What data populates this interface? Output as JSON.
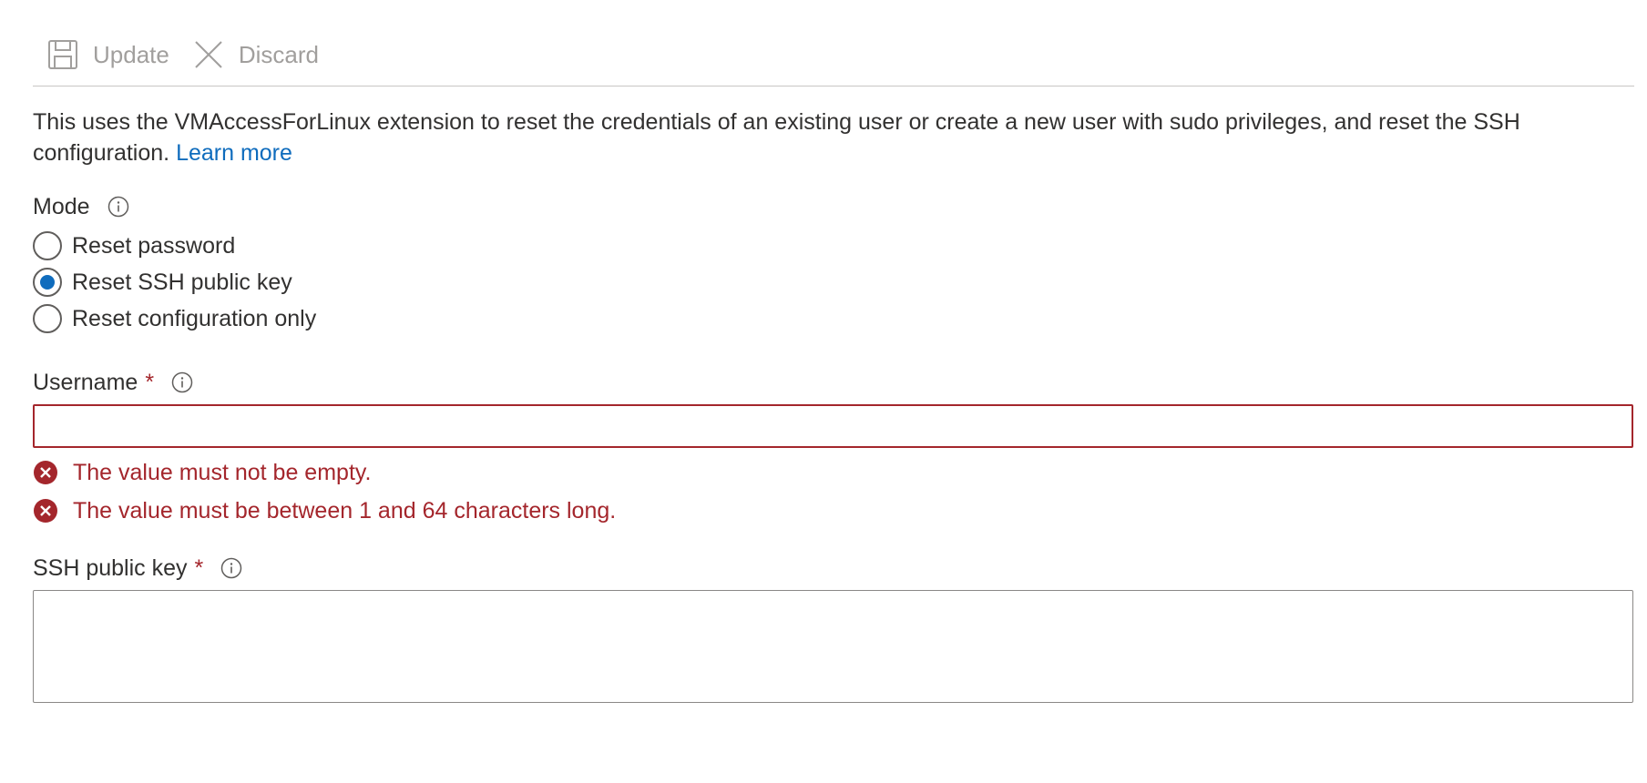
{
  "toolbar": {
    "update_label": "Update",
    "discard_label": "Discard"
  },
  "description": {
    "text": "This uses the VMAccessForLinux extension to reset the credentials of an existing user or create a new user with sudo privileges, and reset the SSH configuration.",
    "link_text": "Learn more"
  },
  "mode": {
    "label": "Mode",
    "selected": "Reset SSH public key",
    "options": [
      "Reset password",
      "Reset SSH public key",
      "Reset configuration only"
    ]
  },
  "username": {
    "label": "Username",
    "required_marker": "*",
    "value": "",
    "errors": [
      "The value must not be empty.",
      "The value must be between 1 and 64 characters long."
    ]
  },
  "ssh_public_key": {
    "label": "SSH public key",
    "required_marker": "*",
    "value": ""
  },
  "colors": {
    "accent": "#0f6cbd",
    "error": "#a4262c",
    "disabled_text": "#a19f9d"
  },
  "icons": {
    "update": "save-icon",
    "discard": "close-icon",
    "info": "info-icon",
    "error": "error-circle-icon"
  }
}
